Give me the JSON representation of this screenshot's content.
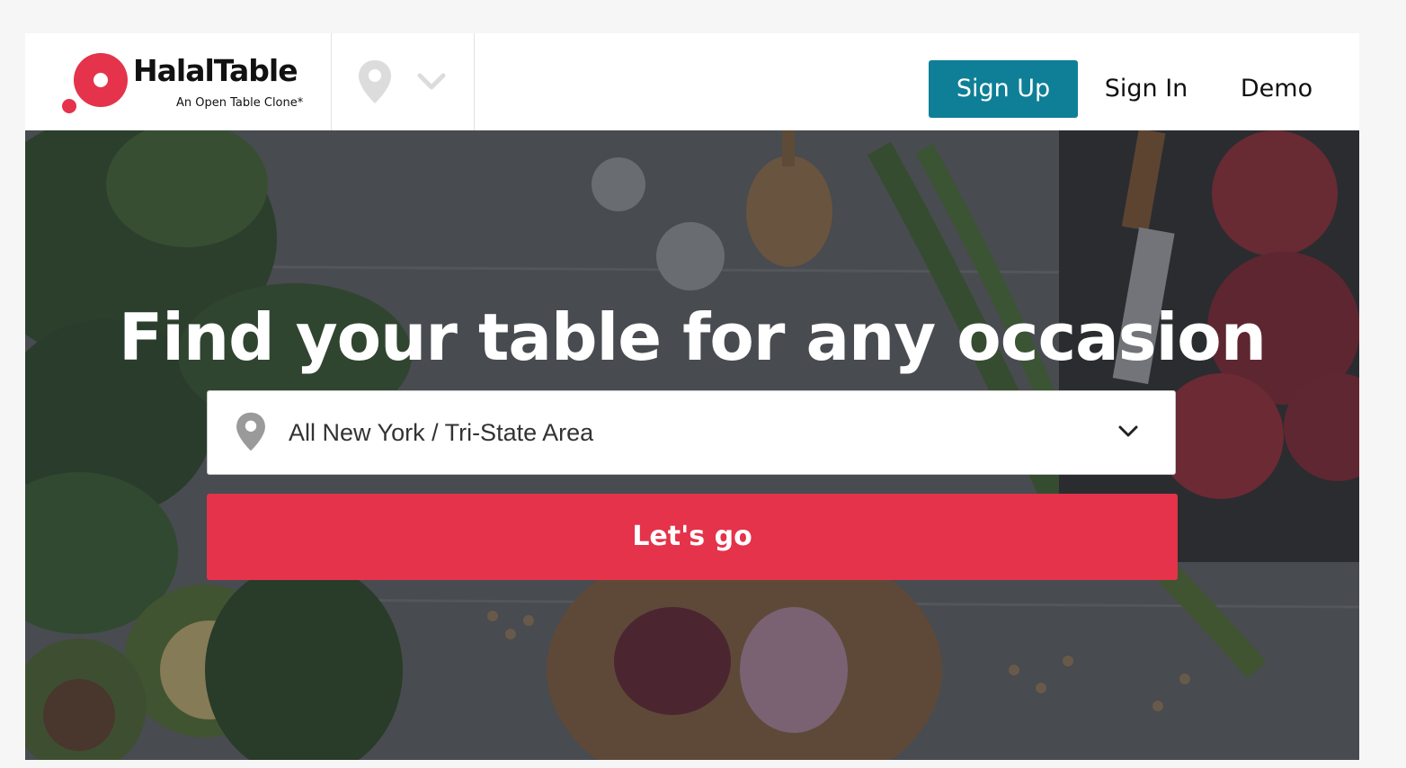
{
  "header": {
    "logo_name": "HalalTable",
    "logo_tagline": "An Open Table Clone*",
    "nav": {
      "signup_label": "Sign Up",
      "signin_label": "Sign In",
      "demo_label": "Demo"
    },
    "location_icon": "map-pin-icon",
    "dropdown_icon": "chevron-down-icon"
  },
  "hero": {
    "title": "Find your table for any occasion",
    "location_select": {
      "selected": "All New York / Tri-State Area",
      "icon": "map-pin-icon"
    },
    "cta_label": "Let's go"
  },
  "colors": {
    "brand_red": "#e4334a",
    "signup_teal": "#0f7f97",
    "page_bg": "#f6f6f6"
  }
}
